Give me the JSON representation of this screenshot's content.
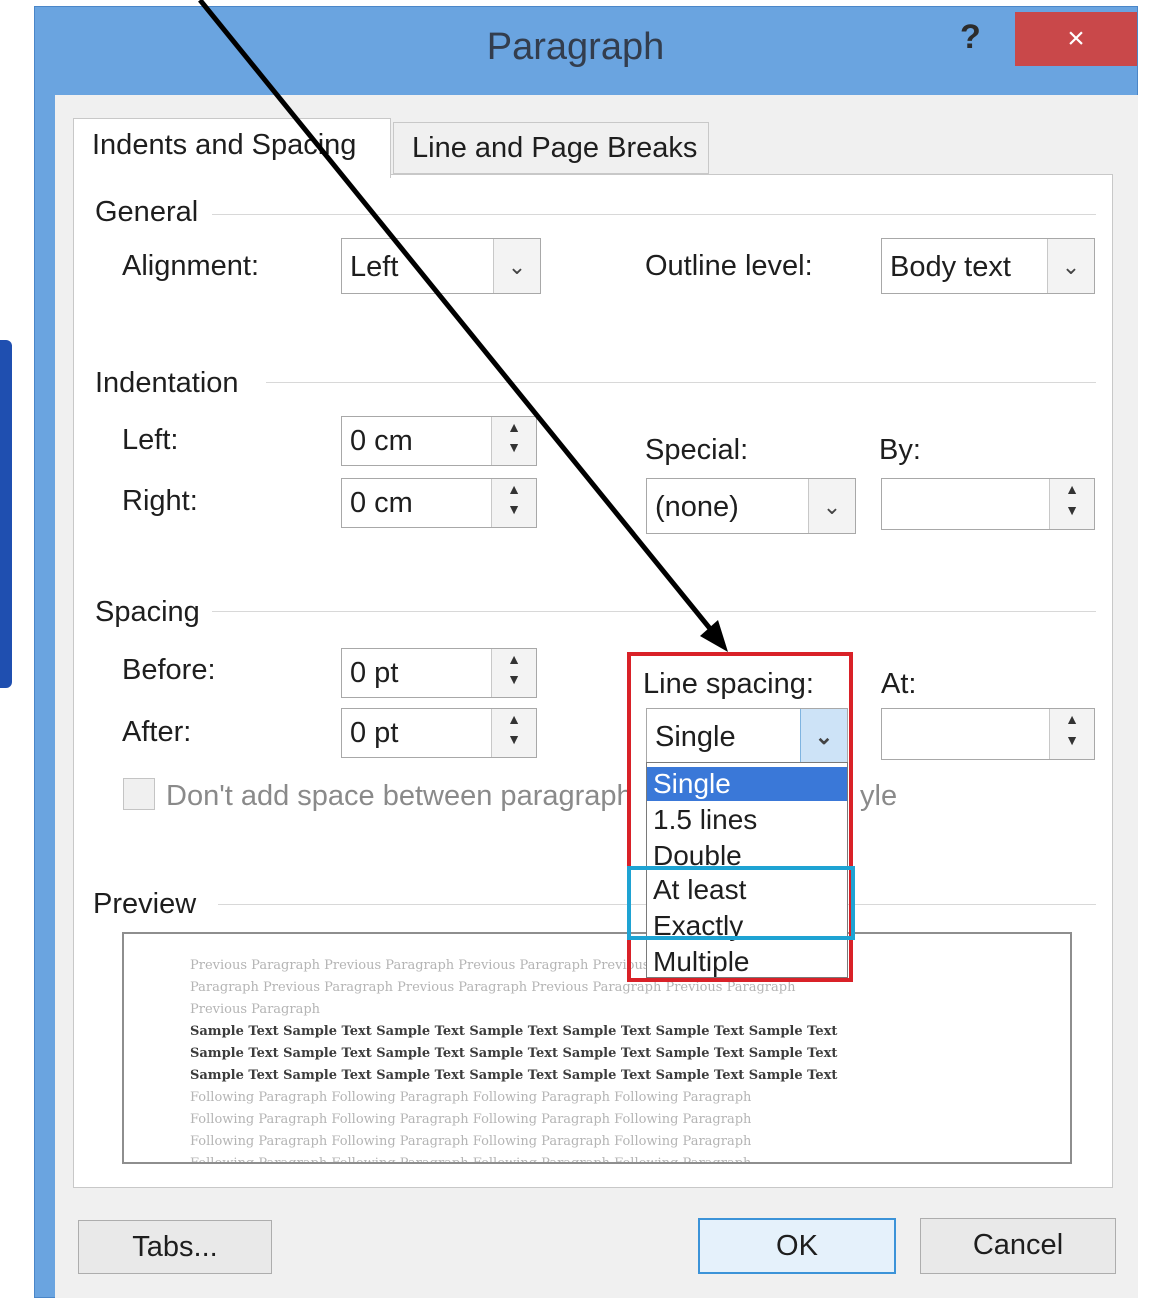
{
  "window": {
    "title": "Paragraph",
    "help_label": "?",
    "close_label": "×"
  },
  "tabs": [
    {
      "label": "Indents and Spacing",
      "active": true
    },
    {
      "label": "Line and Page Breaks",
      "active": false
    }
  ],
  "general": {
    "heading": "General",
    "alignment_label": "Alignment:",
    "alignment_value": "Left",
    "outline_label": "Outline level:",
    "outline_value": "Body text"
  },
  "indentation": {
    "heading": "Indentation",
    "left_label": "Left:",
    "left_value": "0 cm",
    "right_label": "Right:",
    "right_value": "0 cm",
    "special_label": "Special:",
    "special_value": "(none)",
    "by_label": "By:",
    "by_value": ""
  },
  "spacing": {
    "heading": "Spacing",
    "before_label": "Before:",
    "before_value": "0 pt",
    "after_label": "After:",
    "after_value": "0 pt",
    "line_spacing_label": "Line spacing:",
    "line_spacing_value": "Single",
    "at_label": "At:",
    "at_value": "",
    "checkbox_label_left": "Don't add space between paragraph",
    "checkbox_label_right": "yle",
    "options": [
      "Single",
      "1.5 lines",
      "Double",
      "At least",
      "Exactly",
      "Multiple"
    ],
    "selected_option": "Single"
  },
  "preview": {
    "heading": "Preview",
    "previous_lines": [
      "Previous Paragraph Previous Paragraph Previous Paragraph Previous Paragraph Previous",
      "Paragraph Previous Paragraph Previous Paragraph Previous Paragraph Previous Paragraph",
      "Previous Paragraph"
    ],
    "sample_lines": [
      "Sample Text Sample Text Sample Text Sample Text Sample Text Sample Text Sample Text",
      "Sample Text Sample Text Sample Text Sample Text Sample Text Sample Text Sample Text",
      "Sample Text Sample Text Sample Text Sample Text Sample Text Sample Text Sample Text"
    ],
    "following_lines": [
      "Following Paragraph Following Paragraph Following Paragraph Following Paragraph",
      "Following Paragraph Following Paragraph Following Paragraph Following Paragraph",
      "Following Paragraph Following Paragraph Following Paragraph Following Paragraph",
      "Following Paragraph Following Paragraph Following Paragraph Following Paragraph"
    ]
  },
  "buttons": {
    "tabs": "Tabs...",
    "ok": "OK",
    "cancel": "Cancel"
  },
  "colors": {
    "highlight_red": "#d92128",
    "highlight_cyan": "#1ea3d3",
    "title_bar": "#6aa4e0",
    "close_button": "#c9484a",
    "selection": "#3a78d8"
  }
}
